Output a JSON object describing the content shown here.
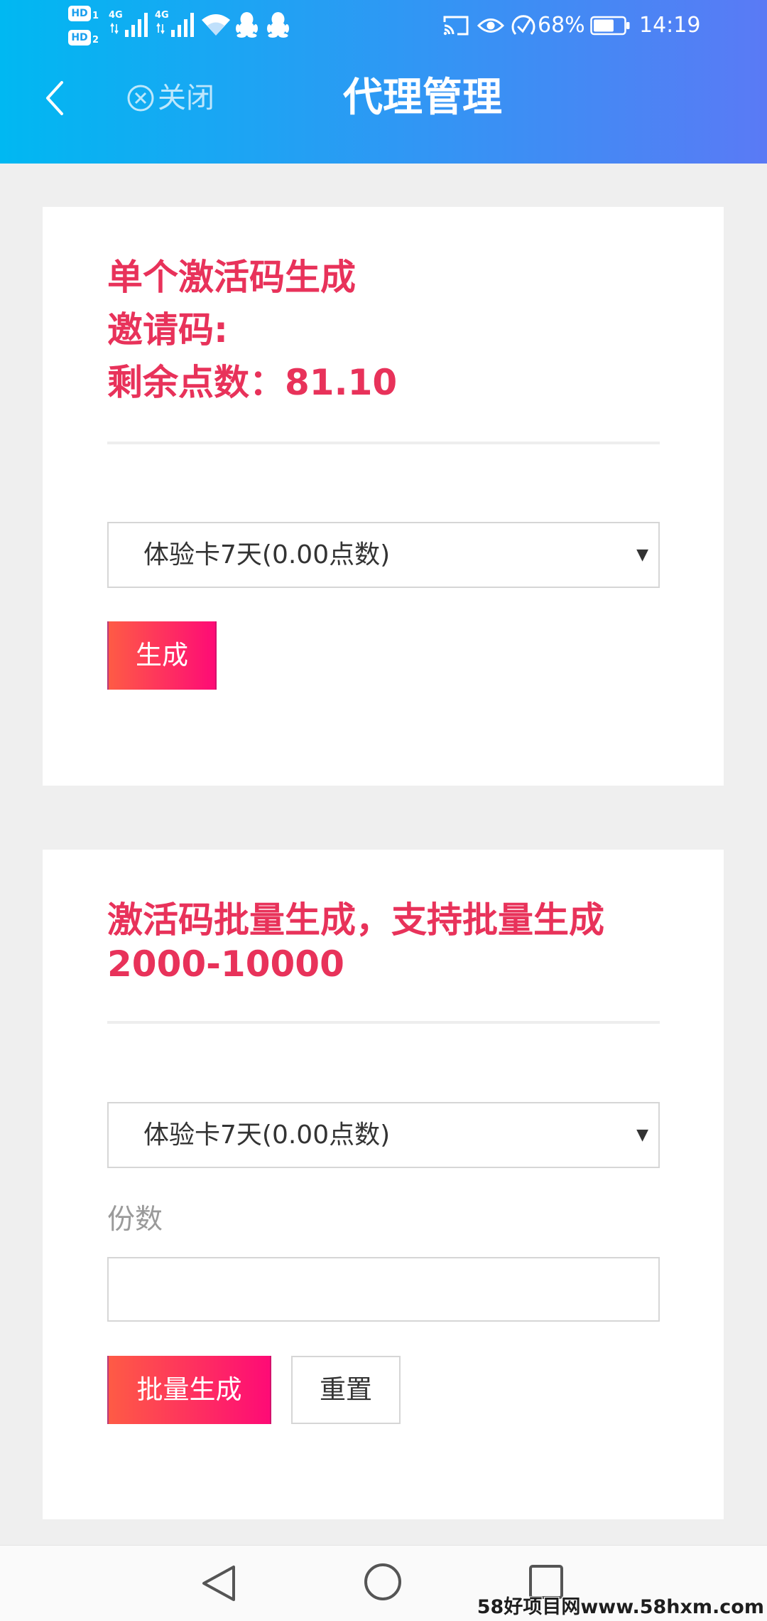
{
  "status_bar": {
    "sim1_badge": "HD",
    "sim1_index": "1",
    "sim2_badge": "HD",
    "sim2_index": "2",
    "sim1_network": "4G",
    "sim2_network": "4G",
    "battery_percent": "68%",
    "battery_level": 0.68,
    "time": "14:19",
    "left_icons": [
      "signal-icon",
      "signal-icon",
      "wifi-icon",
      "qq-icon",
      "qq-icon"
    ],
    "right_icons": [
      "cast-icon",
      "eye-icon",
      "speed-gauge-icon",
      "battery-icon"
    ]
  },
  "header": {
    "back_icon": "chevron-left-icon",
    "close_icon": "close-circle-icon",
    "close_label": "关闭",
    "title": "代理管理"
  },
  "single_panel": {
    "title": "单个激活码生成",
    "invite_label": "邀请码:",
    "points_label": "剩余点数：",
    "points_value": "81.10",
    "card_type_selected": "体验卡7天(0.00点数)",
    "dropdown_icon": "triangle-down-icon",
    "generate_button": "生成"
  },
  "batch_panel": {
    "title_line1": "激活码批量生成，支持批量生成",
    "title_line2": "2000-10000",
    "card_type_selected": "体验卡7天(0.00点数)",
    "dropdown_icon": "triangle-down-icon",
    "count_label": "份数",
    "count_value": "",
    "generate_button": "批量生成",
    "reset_button": "重置"
  },
  "nav_bar": {
    "back_icon": "triangle-back-icon",
    "home_icon": "circle-home-icon",
    "recents_icon": "square-recents-icon"
  },
  "watermark": "58好项目网www.58hxm.com",
  "theme": {
    "header_gradient_start": "#00b8f2",
    "header_gradient_end": "#5a7af5",
    "accent_red": "#e8325a",
    "button_gradient_start": "#fe5b45",
    "button_gradient_end": "#fe0b76",
    "page_background": "#efefef"
  }
}
